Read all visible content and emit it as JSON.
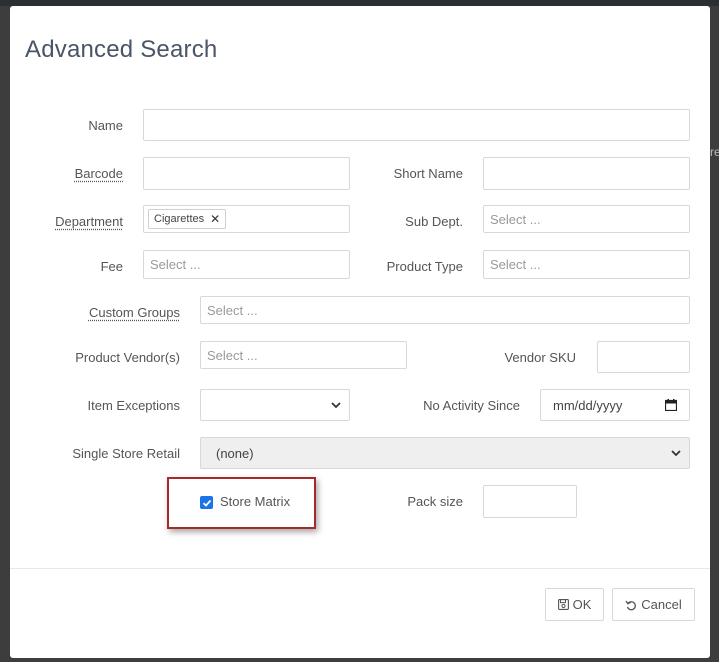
{
  "modal": {
    "title": "Advanced Search"
  },
  "fields": {
    "name": {
      "label": "Name",
      "value": ""
    },
    "barcode": {
      "label": "Barcode",
      "value": ""
    },
    "short_name": {
      "label": "Short Name",
      "value": ""
    },
    "department": {
      "label": "Department",
      "tag": "Cigarettes"
    },
    "sub_dept": {
      "label": "Sub Dept.",
      "placeholder": "Select ..."
    },
    "fee": {
      "label": "Fee",
      "placeholder": "Select ..."
    },
    "product_type": {
      "label": "Product Type",
      "placeholder": "Select ..."
    },
    "custom_groups": {
      "label": "Custom Groups",
      "placeholder": "Select ..."
    },
    "product_vendors": {
      "label": "Product Vendor(s)",
      "placeholder": "Select ..."
    },
    "vendor_sku": {
      "label": "Vendor SKU",
      "value": ""
    },
    "item_exceptions": {
      "label": "Item Exceptions",
      "value": ""
    },
    "no_activity_since": {
      "label": "No Activity Since",
      "value": "mm/dd/yyyy"
    },
    "single_store_retail": {
      "label": "Single Store Retail",
      "value": "(none)"
    },
    "store_matrix": {
      "label": "Store Matrix",
      "checked": true
    },
    "pack_size": {
      "label": "Pack size",
      "value": ""
    }
  },
  "footer": {
    "ok_label": "OK",
    "cancel_label": "Cancel"
  },
  "background": {
    "edge_text": "re"
  },
  "colors": {
    "checkbox_accent": "#1a73e8",
    "highlight_border": "#a52a2a"
  }
}
